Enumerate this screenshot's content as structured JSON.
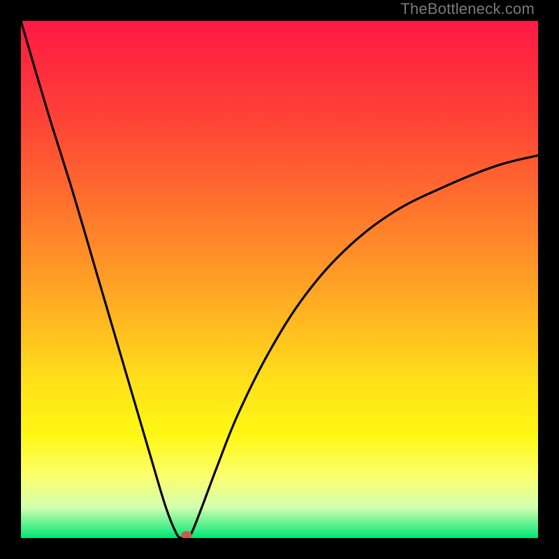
{
  "watermark": "TheBottleneck.com",
  "chart_data": {
    "type": "line",
    "title": "",
    "xlabel": "",
    "ylabel": "",
    "xlim": [
      0,
      100
    ],
    "ylim": [
      0,
      100
    ],
    "series": [
      {
        "name": "curve",
        "x": [
          0,
          5,
          10,
          15,
          20,
          25,
          28,
          30,
          31,
          32,
          33,
          35,
          38,
          42,
          48,
          55,
          63,
          72,
          82,
          92,
          100
        ],
        "y": [
          100,
          83,
          67,
          50,
          33,
          16,
          6,
          1,
          0,
          0,
          1,
          6,
          14,
          24,
          36,
          47,
          56,
          63,
          68,
          72,
          74
        ]
      }
    ],
    "marker": {
      "x": 32,
      "y": 0.5
    },
    "colors": {
      "top": "#ff1a47",
      "mid": "#ffe11a",
      "bottom": "#00e676",
      "curve": "#000000",
      "marker": "#cc5b4f"
    }
  }
}
